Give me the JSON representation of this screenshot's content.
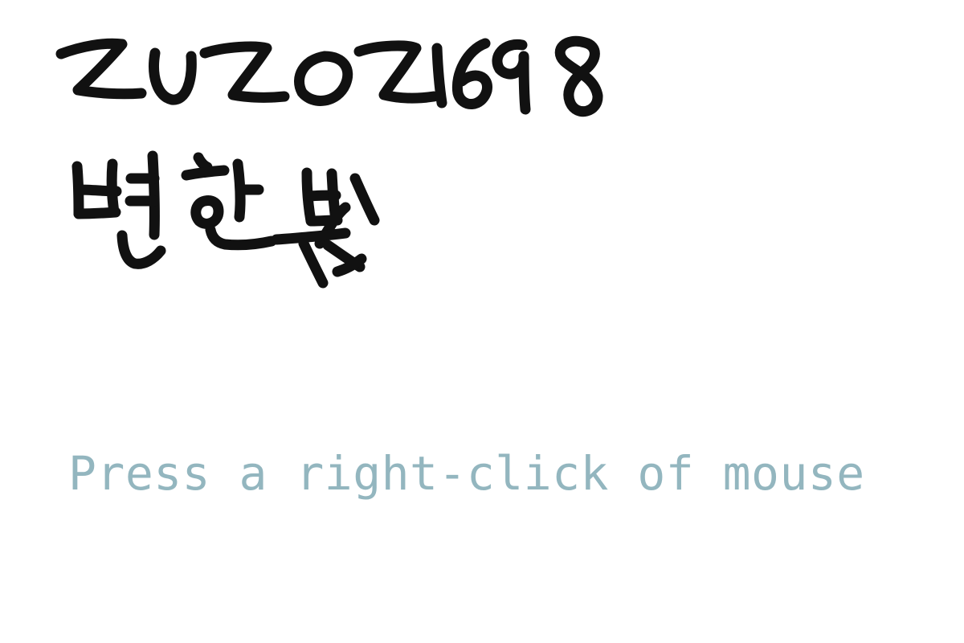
{
  "canvas": {
    "background_color": "#ffffff",
    "ink_color": "#111111",
    "handwriting_line1": "2020021698",
    "handwriting_line2": "변한빛"
  },
  "hint": {
    "text": "Press a right-click of mouse",
    "color": "#93b6bf"
  }
}
